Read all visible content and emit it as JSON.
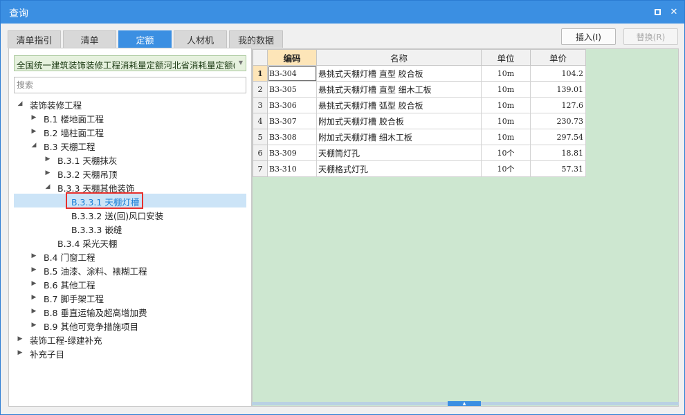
{
  "window": {
    "title": "查询"
  },
  "tabs": [
    "清单指引",
    "清单",
    "定额",
    "人材机",
    "我的数据"
  ],
  "active_tab": "定额",
  "buttons": {
    "insert": "插入(I)",
    "replace": "替换(R)"
  },
  "quota_library": "全国统一建筑装饰装修工程消耗量定额河北省消耗量定额(20",
  "search": {
    "placeholder": "搜索",
    "value": ""
  },
  "tree": [
    {
      "label": "装饰装修工程",
      "expanded": true
    },
    {
      "label": "B.1 楼地面工程",
      "expanded": false
    },
    {
      "label": "B.2 墙柱面工程",
      "expanded": false
    },
    {
      "label": "B.3 天棚工程",
      "expanded": true
    },
    {
      "label": "B.3.1 天棚抹灰",
      "expanded": false
    },
    {
      "label": "B.3.2 天棚吊顶",
      "expanded": false
    },
    {
      "label": "B.3.3 天棚其他装饰",
      "expanded": true
    },
    {
      "label": "B.3.3.1 天棚灯槽",
      "selected": true
    },
    {
      "label": "B.3.3.2 送(回)风口安装"
    },
    {
      "label": "B.3.3.3 嵌缝"
    },
    {
      "label": "B.3.4 采光天棚"
    },
    {
      "label": "B.4 门窗工程",
      "expanded": false
    },
    {
      "label": "B.5 油漆、涂料、裱糊工程",
      "expanded": false
    },
    {
      "label": "B.6 其他工程",
      "expanded": false
    },
    {
      "label": "B.7 脚手架工程",
      "expanded": false
    },
    {
      "label": "B.8 垂直运输及超高增加费",
      "expanded": false
    },
    {
      "label": "B.9 其他可竞争措施项目",
      "expanded": false
    },
    {
      "label": "装饰工程-绿建补充",
      "expanded": false
    },
    {
      "label": "补充子目",
      "expanded": false
    }
  ],
  "table": {
    "headers": [
      "编码",
      "名称",
      "单位",
      "单价"
    ],
    "rows": [
      {
        "no": "1",
        "code": "B3-304",
        "name": "悬挑式天棚灯槽 直型 胶合板",
        "unit": "10m",
        "price": "104.2"
      },
      {
        "no": "2",
        "code": "B3-305",
        "name": "悬挑式天棚灯槽 直型 细木工板",
        "unit": "10m",
        "price": "139.01"
      },
      {
        "no": "3",
        "code": "B3-306",
        "name": "悬挑式天棚灯槽 弧型 胶合板",
        "unit": "10m",
        "price": "127.6"
      },
      {
        "no": "4",
        "code": "B3-307",
        "name": "附加式天棚灯槽 胶合板",
        "unit": "10m",
        "price": "230.73"
      },
      {
        "no": "5",
        "code": "B3-308",
        "name": "附加式天棚灯槽 细木工板",
        "unit": "10m",
        "price": "297.54"
      },
      {
        "no": "6",
        "code": "B3-309",
        "name": "天棚筒灯孔",
        "unit": "10个",
        "price": "18.81"
      },
      {
        "no": "7",
        "code": "B3-310",
        "name": "天棚格式灯孔",
        "unit": "10个",
        "price": "57.31"
      }
    ]
  },
  "colors": {
    "accent": "#3b8fe2",
    "highlight_box": "#e8302c",
    "grid_background": "#cde7d0",
    "sorted_header": "#fde5b8"
  },
  "icons": {
    "restore": "restore-window-icon",
    "close": "close-icon",
    "expanded": "triangle-down-icon",
    "collapsed": "triangle-right-icon",
    "dropdown": "dropdown-arrow-icon"
  }
}
